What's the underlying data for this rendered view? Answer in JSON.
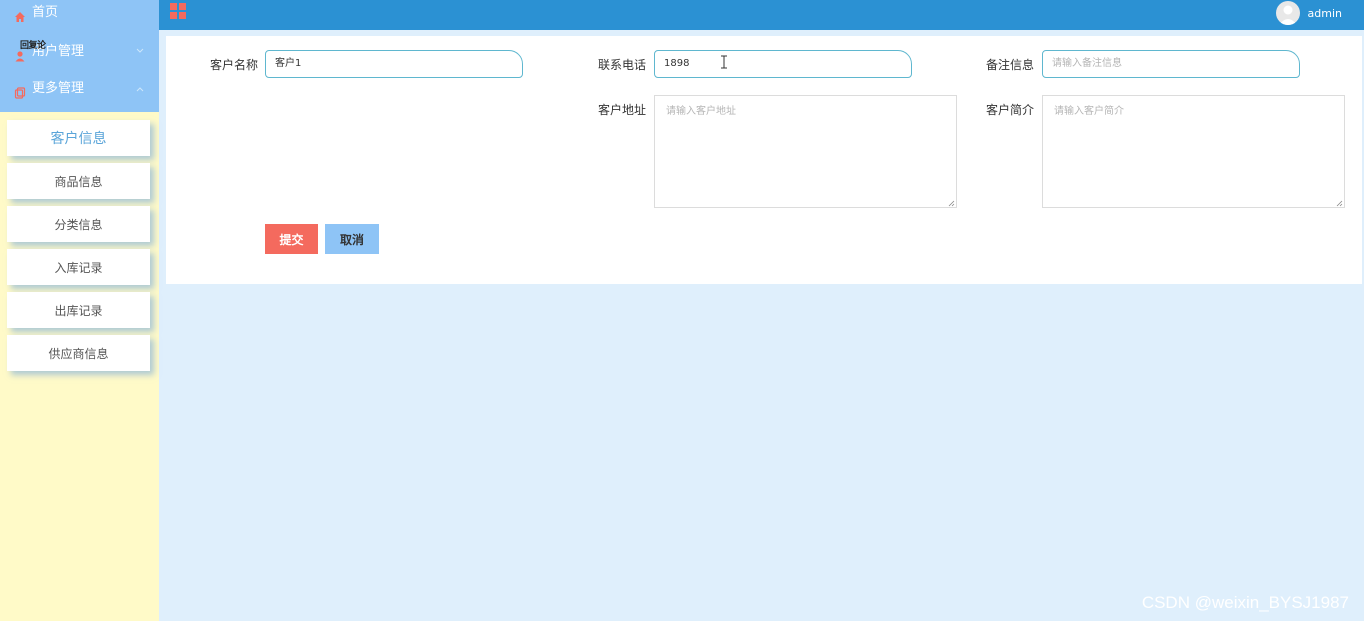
{
  "sidebar": {
    "floating_tag": "回复论",
    "menu": [
      {
        "label": "首页",
        "icon": "home-icon"
      },
      {
        "label": "用户管理",
        "icon": "user-icon"
      },
      {
        "label": "更多管理",
        "icon": "copy-icon"
      }
    ],
    "sub_items": [
      "客户信息",
      "商品信息",
      "分类信息",
      "入库记录",
      "出库记录",
      "供应商信息"
    ]
  },
  "header": {
    "user": "admin"
  },
  "form": {
    "customer_name": {
      "label": "客户名称",
      "value": "客户1"
    },
    "phone": {
      "label": "联系电话",
      "value": "1898"
    },
    "remark": {
      "label": "备注信息",
      "placeholder": "请输入备注信息"
    },
    "address": {
      "label": "客户地址",
      "placeholder": "请输入客户地址"
    },
    "intro": {
      "label": "客户简介",
      "placeholder": "请输入客户简介"
    },
    "submit_label": "提交",
    "cancel_label": "取消"
  },
  "watermark": "CSDN @weixin_BYSJ1987",
  "colors": {
    "sidebar_top": "#8ec4f6",
    "sidebar_bg": "#fffac8",
    "topbar": "#2b91d3",
    "submit": "#f46a5e",
    "cancel": "#8ec4f6",
    "content_bg": "#dfeffc"
  }
}
